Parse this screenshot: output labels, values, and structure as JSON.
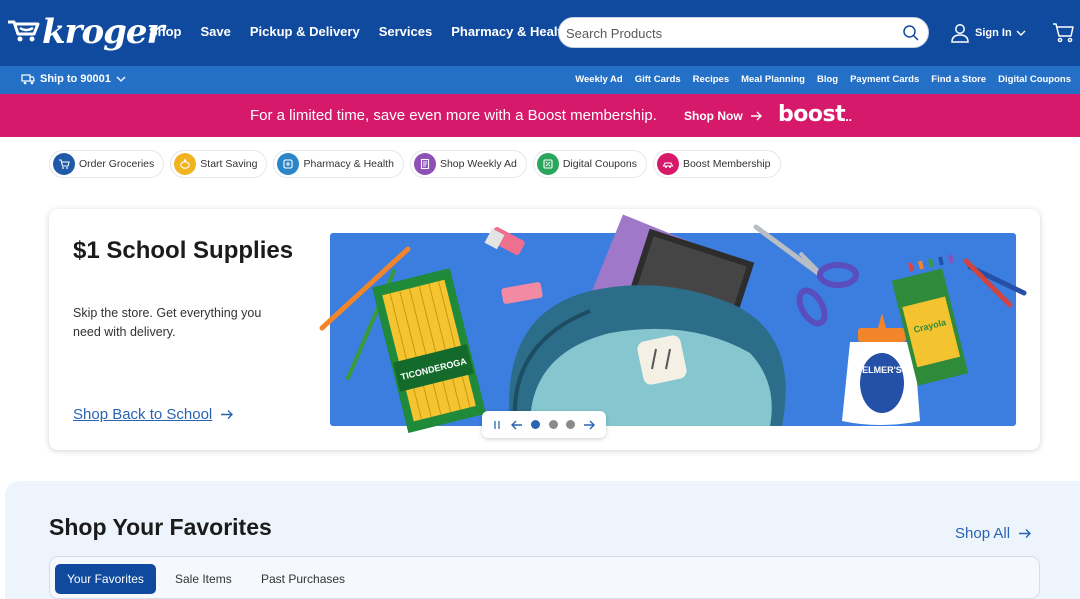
{
  "header": {
    "logo_text": "kroger",
    "nav": [
      "Shop",
      "Save",
      "Pickup & Delivery",
      "Services",
      "Pharmacy & Health"
    ],
    "search_placeholder": "Search Products",
    "sign_in": "Sign In"
  },
  "subheader": {
    "ship_to": "Ship to 90001",
    "links": [
      "Weekly Ad",
      "Gift Cards",
      "Recipes",
      "Meal Planning",
      "Blog",
      "Payment Cards",
      "Find a Store",
      "Digital Coupons"
    ]
  },
  "promo": {
    "text": "For a limited time, save even more with a Boost membership.",
    "link": "Shop Now",
    "logo": "boost"
  },
  "pills": [
    {
      "label": "Order Groceries",
      "icon": "cart-icon",
      "color": "#1f5aa8"
    },
    {
      "label": "Start Saving",
      "icon": "piggy-bank-icon",
      "color": "#f2b321"
    },
    {
      "label": "Pharmacy & Health",
      "icon": "pharmacy-icon",
      "color": "#2a86c8"
    },
    {
      "label": "Shop Weekly Ad",
      "icon": "weekly-ad-icon",
      "color": "#8e4fb7"
    },
    {
      "label": "Digital Coupons",
      "icon": "coupon-icon",
      "color": "#2aa65c"
    },
    {
      "label": "Boost Membership",
      "icon": "boost-icon",
      "color": "#d6196a"
    }
  ],
  "hero": {
    "title": "$1 School Supplies",
    "subtitle": "Skip the store. Get everything you need with delivery.",
    "link": "Shop Back to School",
    "pencil_box_text": "TICONDEROGA",
    "crayon_box_text": "Crayola",
    "glue_text": "ELMER'S",
    "carousel": {
      "slides": 3,
      "active_index": 0
    }
  },
  "favorites": {
    "title": "Shop Your Favorites",
    "shop_all": "Shop All",
    "tabs": [
      "Your Favorites",
      "Sale Items",
      "Past Purchases"
    ],
    "active_tab": 0
  },
  "colors": {
    "header_blue": "#0f4a9e",
    "subheader_blue": "#2570c7",
    "boost_pink": "#d6196a",
    "link_blue": "#2b63b3"
  }
}
